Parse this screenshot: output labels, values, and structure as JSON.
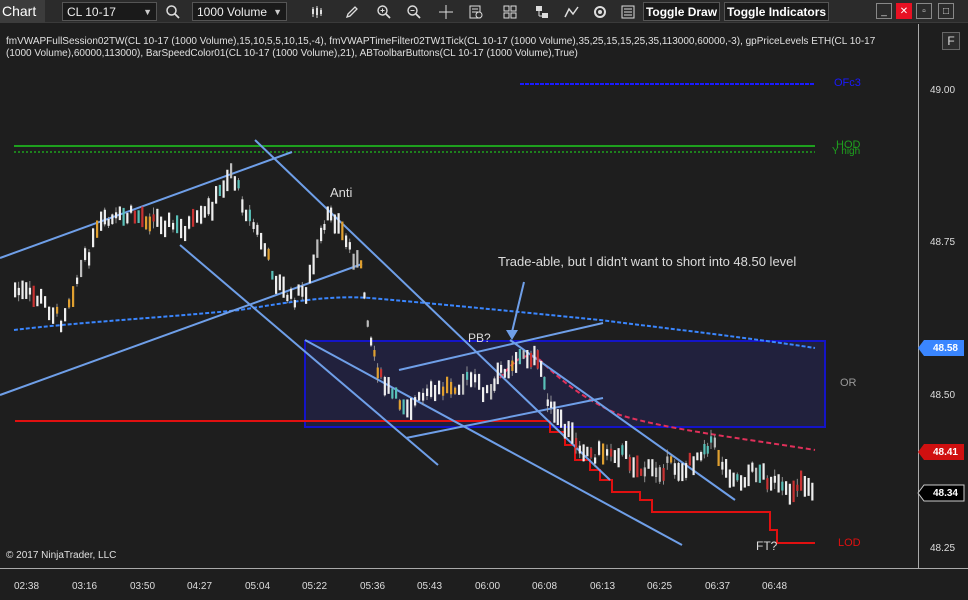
{
  "toolbar": {
    "chart_tab": "Chart",
    "instrument": "CL 10-17",
    "period": "1000 Volume",
    "toggle_draw": "Toggle Draw",
    "toggle_indicators": "Toggle Indicators",
    "icons": [
      "search-icon",
      "bar-style-icon",
      "pencil-icon",
      "zoom-in-icon",
      "zoom-out-icon",
      "crosshair-icon",
      "properties-icon",
      "templates-icon",
      "strategies-icon",
      "chart-style-icon",
      "refresh-icon",
      "data-box-icon"
    ]
  },
  "indicators_line1": "fmVWAPFullSession02TW(CL 10-17 (1000 Volume),15,10,5,5,10,15,-4), fmVWAPTimeFilter02TW1Tick(CL 10-17 (1000 Volume),35,25,15,15,25,35,113000,60000,-3), gpPriceLevels ETH(CL 10-17",
  "indicators_line2": "(1000 Volume),60000,113000), BarSpeedColor01(CL 10-17 (1000 Volume),21), ABToolbarButtons(CL 10-17 (1000 Volume),True)",
  "copyright": "© 2017 NinjaTrader, LLC",
  "f_button": "F",
  "price_ticks": [
    "49.00",
    "48.75",
    "48.50",
    "48.25"
  ],
  "price_labels": {
    "vwap": "48.58",
    "red": "48.41",
    "last": "48.34"
  },
  "time_ticks": [
    "02:38",
    "03:16",
    "03:50",
    "04:27",
    "05:04",
    "05:22",
    "05:36",
    "05:43",
    "06:00",
    "06:08",
    "06:13",
    "06:25",
    "06:37",
    "06:48"
  ],
  "level_labels": {
    "ofc3": "OFc3",
    "hod": "HOD",
    "yhigh": "Y high",
    "or": "OR",
    "lod": "LOD"
  },
  "annotations": {
    "anti": "Anti",
    "tradeable": "Trade-able, but I didn't want to short into 48.50 level",
    "pb": "PB?",
    "ft": "FT?"
  },
  "colors": {
    "up_bar": "#f0f0f0",
    "down_bar": "#c0c0c0",
    "vwap": "#3a86ff",
    "trend_line": "#6f9fe8",
    "or_box": "#1414c8",
    "red_level": "#e01010",
    "hod": "#1ea01e",
    "ofc3": "#1a1aff",
    "vwap_tf": "#e0305a",
    "last_label": "#000000",
    "vwap_label": "#3a86ff",
    "red_label": "#d01010"
  }
}
